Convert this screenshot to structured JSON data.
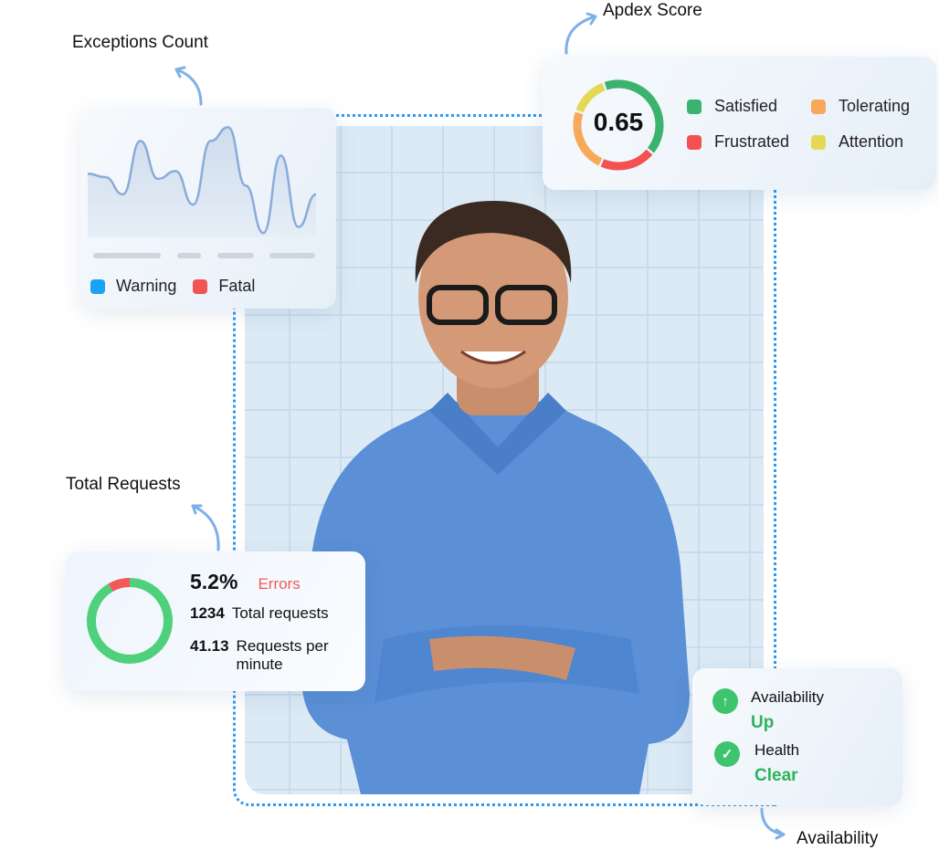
{
  "exceptions": {
    "title": "Exceptions Count",
    "series": [
      74,
      70,
      50,
      112,
      68,
      77,
      38,
      112,
      128,
      60,
      5,
      95,
      12,
      50
    ],
    "legend": [
      {
        "label": "Warning",
        "color": "#1aa3f5"
      },
      {
        "label": "Fatal",
        "color": "#f25454"
      }
    ]
  },
  "apdex": {
    "title": "Apdex Score",
    "score": "0.65",
    "legend": [
      {
        "label": "Satisfied",
        "color": "#3bb36e"
      },
      {
        "label": "Tolerating",
        "color": "#f9a85a"
      },
      {
        "label": "Frustrated",
        "color": "#f45252"
      },
      {
        "label": "Attention",
        "color": "#e3d955"
      }
    ]
  },
  "requests": {
    "title": "Total Requests",
    "error_pct": "5.2%",
    "error_label": "Errors",
    "total_value": "1234",
    "total_label": "Total requests",
    "rpm_value": "41.13",
    "rpm_label": "Requests per minute",
    "error_fraction": 0.052,
    "colors": {
      "ok": "#4fd07a",
      "error": "#f25a5a"
    }
  },
  "availability": {
    "title": "Availability",
    "availability_label": "Availability",
    "availability_value": "Up",
    "health_label": "Health",
    "health_value": "Clear"
  }
}
